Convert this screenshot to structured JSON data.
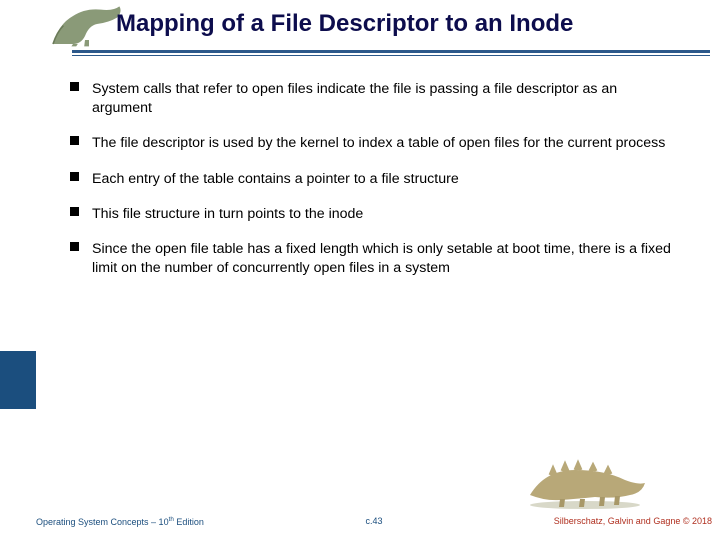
{
  "title": "Mapping of a File Descriptor to an Inode",
  "bullets": [
    "System calls that refer to open files indicate the file is passing a file descriptor as an argument",
    "The file descriptor is used by the kernel to index a table of open files for the current process",
    "Each entry of the table contains a pointer to a file structure",
    "This file structure in turn points to the inode",
    "Since the open file table has a fixed length which is only setable at boot time, there is a fixed limit on the number of concurrently open files in a system"
  ],
  "footer": {
    "left_prefix": "Operating System Concepts – 10",
    "left_suffix": " Edition",
    "left_sup": "th",
    "center": "c.43",
    "right": "Silberschatz, Galvin and Gagne © 2018"
  }
}
